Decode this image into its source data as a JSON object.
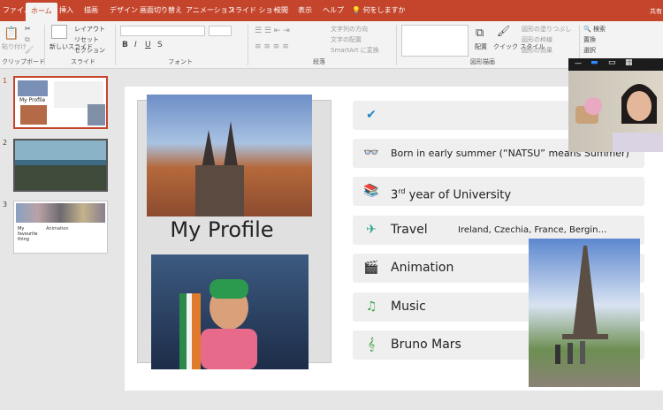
{
  "tabs": [
    "ファイル",
    "ホーム",
    "挿入",
    "描画",
    "デザイン",
    "画面切り替え",
    "アニメーション",
    "スライド ショー",
    "校閲",
    "表示",
    "ヘルプ",
    "何をしますか"
  ],
  "ribbon": {
    "clipboard": "クリップボード",
    "paste": "貼り付け",
    "slides": "スライド",
    "new_slide": "新しいスライド",
    "layout": "レイアウト",
    "reset": "リセット",
    "section": "セクション",
    "font": "フォント",
    "paragraph": "段落",
    "text_dir": "文字列の方向",
    "align_text": "文字の配置",
    "smartart": "SmartArt に変換",
    "drawing": "図形描画",
    "arrange": "配置",
    "quick_styles": "クイック スタイル",
    "shape_fill": "図形の塗りつぶし",
    "shape_outline": "図形の枠線",
    "shape_effects": "図形の効果",
    "search": "検索",
    "replace": "置換",
    "select": "選択",
    "partial": "共有"
  },
  "slides": [
    {
      "num": "1",
      "title": "My Profile"
    },
    {
      "num": "2"
    },
    {
      "num": "3",
      "title": "My favourite thing",
      "text": "Animation"
    }
  ],
  "slide": {
    "title": "My Profile",
    "rows": [
      {
        "icon": "check-icon",
        "text": ""
      },
      {
        "icon": "glasses-icon",
        "text": "Born in early summer (“NATSU” means Summer)"
      },
      {
        "icon": "books-icon",
        "pre": "3",
        "sup": "rd",
        "post": " year of University"
      },
      {
        "icon": "airplane-icon",
        "text": "Travel",
        "extra": "Ireland, Czechia, France, Bergin…"
      },
      {
        "icon": "clapper-icon",
        "text": "Animation"
      },
      {
        "icon": "music-note-icon",
        "text": "Music"
      },
      {
        "icon": "treble-clef-icon",
        "text": "Bruno Mars"
      }
    ]
  },
  "colors": {
    "accent": "#c4452c",
    "icon_blue": "#1e88c8",
    "icon_teal": "#2aa58c",
    "icon_green": "#43a047"
  }
}
